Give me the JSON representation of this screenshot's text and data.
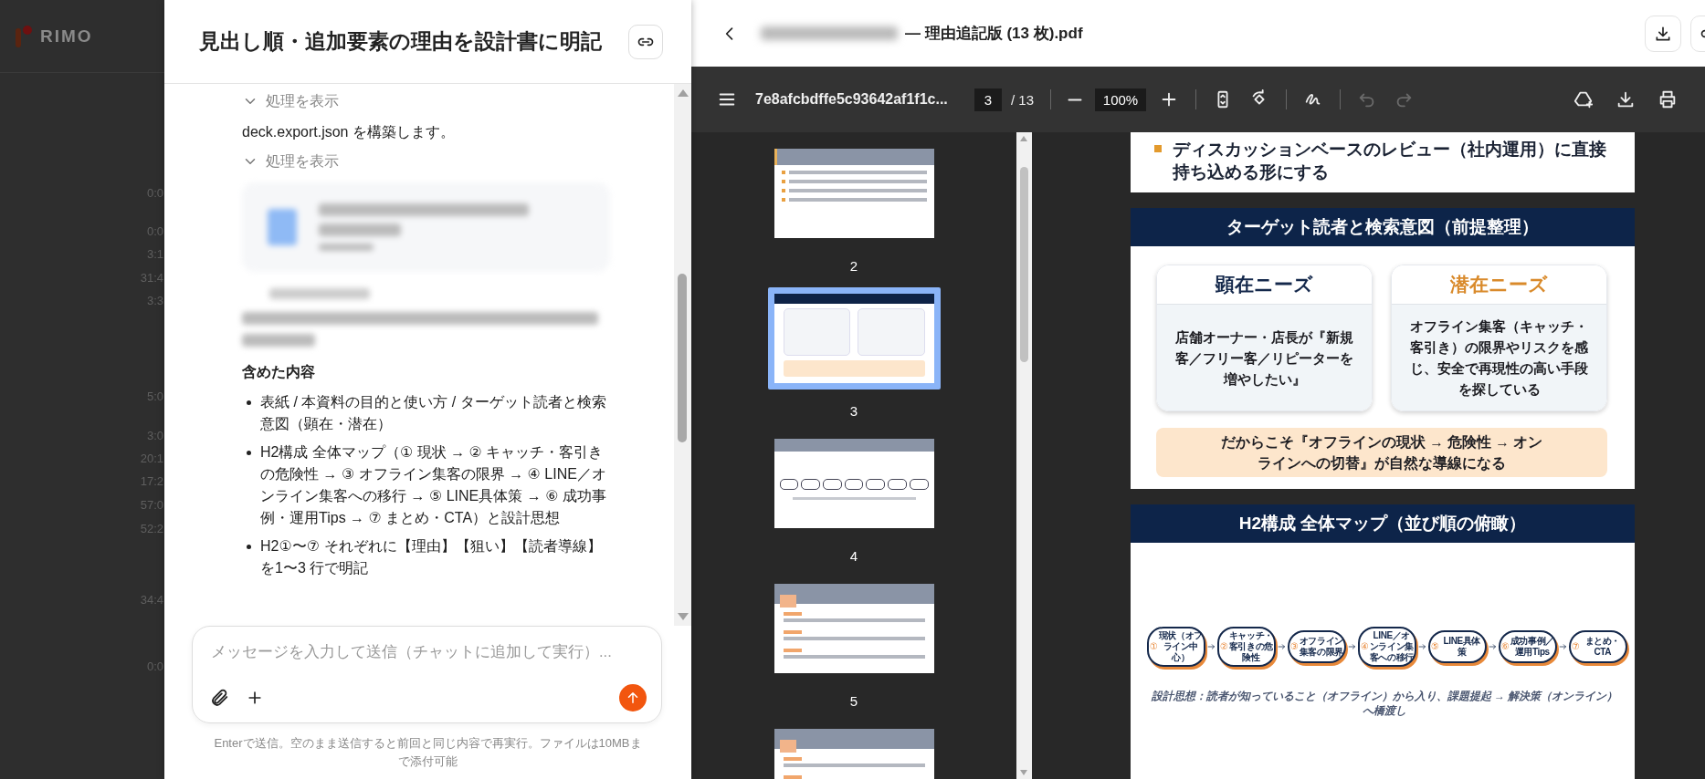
{
  "app_background": {
    "logo": "RIMO",
    "timestamps": [
      "0:0",
      "0:0",
      "3:1",
      "31:4",
      "3:3",
      "5:0",
      "3:0",
      "20:1",
      "17:2",
      "57:0",
      "52:2",
      "34:4",
      "0:0"
    ]
  },
  "chat": {
    "title": "見出し順・追加要素の理由を設計書に明記",
    "messages": [
      {
        "kind": "toggle",
        "label": "処理を表示"
      },
      {
        "kind": "text",
        "text": "deck.export.json を構築します。"
      },
      {
        "kind": "toggle",
        "label": "処理を表示"
      },
      {
        "kind": "blurred_card"
      },
      {
        "kind": "blurred_toggle"
      },
      {
        "kind": "blurred_text"
      },
      {
        "kind": "heading",
        "text": "含めた内容"
      },
      {
        "kind": "bullets",
        "items": [
          "表紙 / 本資料の目的と使い方 / ターゲット読者と検索意図（顕在・潜在）",
          "H2構成 全体マップ（① 現状 → ② キャッチ・客引きの危険性 → ③ オフライン集客の限界 → ④ LINE／オンライン集客への移行 → ⑤ LINE具体策 → ⑥ 成功事例・運用Tips → ⑦ まとめ・CTA）と設計思想",
          "H2①〜⑦ それぞれに【理由】【狙い】【読者導線】を1〜3 行で明記"
        ]
      }
    ],
    "composer": {
      "placeholder": "メッセージを入力して送信（チャットに追加して実行）..."
    },
    "hint": "Enterで送信。空のまま送信すると前回と同じ内容で再実行。ファイルは10MBまで添付可能"
  },
  "viewer": {
    "title": "— 理由追記版 (13 枚).pdf",
    "toolbar": {
      "filename": "7e8afcbdffe5c93642af1f1c...",
      "page": "3",
      "page_total": "/ 13",
      "zoom": "100%",
      "history": [
        {
          "kind": "undo",
          "disabled": true
        },
        {
          "kind": "redo",
          "disabled": true
        }
      ]
    },
    "thumbnails": [
      {
        "kind": "bullets",
        "label": "2",
        "selected": false
      },
      {
        "kind": "needs",
        "label": "3",
        "selected": true
      },
      {
        "kind": "flow",
        "label": "4",
        "selected": false
      },
      {
        "kind": "section",
        "label": "5",
        "selected": false
      },
      {
        "kind": "section",
        "selected": false
      }
    ],
    "pages": [
      {
        "kind": "bullets",
        "items": [
          "ディスカッションベースのレビュー（社内運用）に直接持ち込める形にする"
        ]
      },
      {
        "kind": "needs",
        "title": "ターゲット読者と検索意図（前提整理）",
        "cards": [
          {
            "title": "顕在ニーズ",
            "color": "#14284b",
            "text": "店舗オーナー・店長が『新規客／フリー客／リピーターを増やしたい』"
          },
          {
            "title": "潜在ニーズ",
            "color": "#d98a2b",
            "text": "オフライン集客（キャッチ・客引き）の限界やリスクを感じ、安全で再現性の高い手段を探している"
          }
        ],
        "banner": "だからこそ『オフラインの現状 → 危険性 → オンラインへの切替』が自然な導線になる"
      },
      {
        "kind": "flow",
        "title": "H2構成 全体マップ（並び順の俯瞰）",
        "steps": [
          {
            "num": "①",
            "text": "現状（オフライン中心）"
          },
          {
            "num": "②",
            "text": "キャッチ・客引きの危険性"
          },
          {
            "num": "③",
            "text": "オフライン集客の限界"
          },
          {
            "num": "④",
            "text": "LINE／オンライン集客への移行"
          },
          {
            "num": "⑤",
            "text": "LINE具体策"
          },
          {
            "num": "⑥",
            "text": "成功事例／運用Tips"
          },
          {
            "num": "⑦",
            "text": "まとめ・CTA"
          }
        ],
        "note": "設計思想：読者が知っていること（オフライン）から入り、課題提起 → 解決策（オンライン）へ橋渡し"
      }
    ]
  }
}
